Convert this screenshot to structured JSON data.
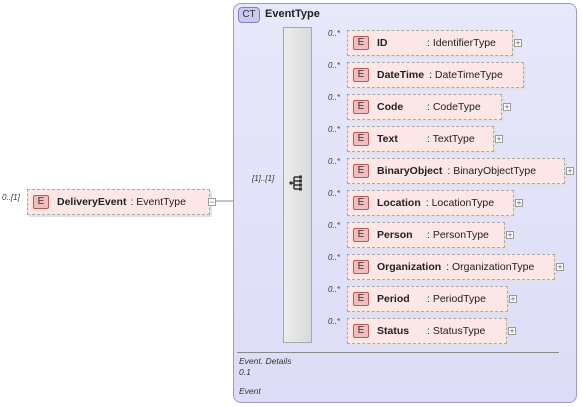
{
  "root": {
    "cardinality": "0..[1]",
    "badge": "E",
    "name": "DeliveryEvent",
    "type": ": EventType",
    "expander": "−"
  },
  "complex_type": {
    "badge": "CT",
    "title": "EventType",
    "sequence_cardinality": "[1]..[1]"
  },
  "children": [
    {
      "cardinality": "0..*",
      "badge": "E",
      "name": "ID",
      "type": ": IdentifierType",
      "expander": "+"
    },
    {
      "cardinality": "0..*",
      "badge": "E",
      "name": "DateTime",
      "type": ": DateTimeType",
      "expander": ""
    },
    {
      "cardinality": "0..*",
      "badge": "E",
      "name": "Code",
      "type": ": CodeType",
      "expander": "+"
    },
    {
      "cardinality": "0..*",
      "badge": "E",
      "name": "Text",
      "type": ": TextType",
      "expander": "+"
    },
    {
      "cardinality": "0..*",
      "badge": "E",
      "name": "BinaryObject",
      "type": ": BinaryObjectType",
      "expander": "+"
    },
    {
      "cardinality": "0..*",
      "badge": "E",
      "name": "Location",
      "type": ": LocationType",
      "expander": "+"
    },
    {
      "cardinality": "0..*",
      "badge": "E",
      "name": "Person",
      "type": ": PersonType",
      "expander": "+"
    },
    {
      "cardinality": "0..*",
      "badge": "E",
      "name": "Organization",
      "type": ": OrganizationType",
      "expander": "+"
    },
    {
      "cardinality": "0..*",
      "badge": "E",
      "name": "Period",
      "type": ": PeriodType",
      "expander": "+"
    },
    {
      "cardinality": "0..*",
      "badge": "E",
      "name": "Status",
      "type": ": StatusType",
      "expander": "+"
    }
  ],
  "footer": {
    "line1": "Event. Details",
    "line2": "0.1",
    "line3": "Event"
  },
  "icons": {
    "sequence": "sequence-compositor-icon",
    "expand": "plus-icon",
    "collapse": "minus-icon"
  }
}
